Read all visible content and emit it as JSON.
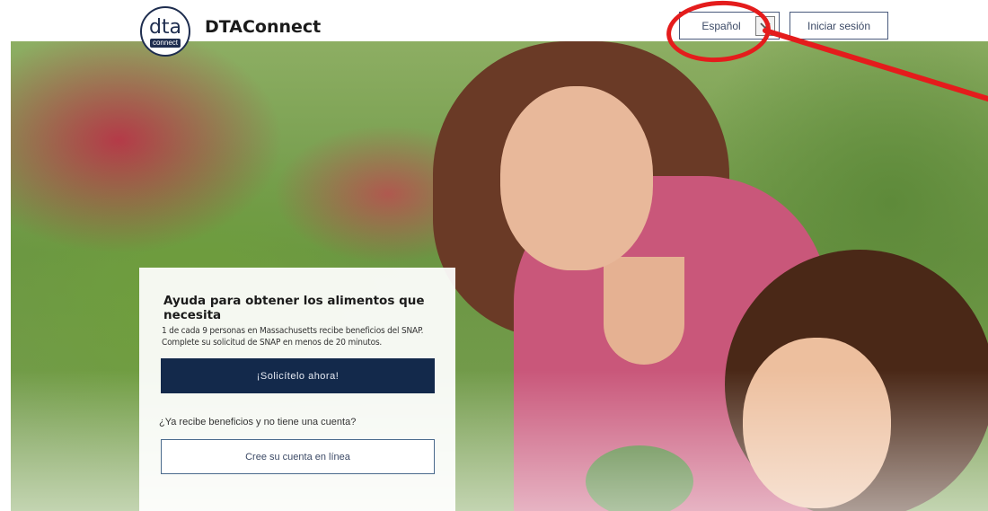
{
  "header": {
    "brand": "DTAConnect",
    "logo_text": "dta",
    "logo_sub": "connect",
    "language_label": "Español",
    "login_label": "Iniciar sesión"
  },
  "card": {
    "title": "Ayuda para obtener los alimentos que necesita",
    "description_lines": [
      "1 de cada 9 personas en Massachusetts recibe beneficios del SNAP.",
      "Complete su solicitud de SNAP en menos de 20 minutos."
    ],
    "apply_button": "¡Solicítelo ahora!",
    "question": "¿Ya recibe beneficios y no tiene una cuenta?",
    "create_account_button": "Cree su cuenta en línea"
  },
  "colors": {
    "primary": "#13294b",
    "annotation": "#e41c1c"
  },
  "icons": {
    "language_dropdown": "chevron-down-icon"
  }
}
